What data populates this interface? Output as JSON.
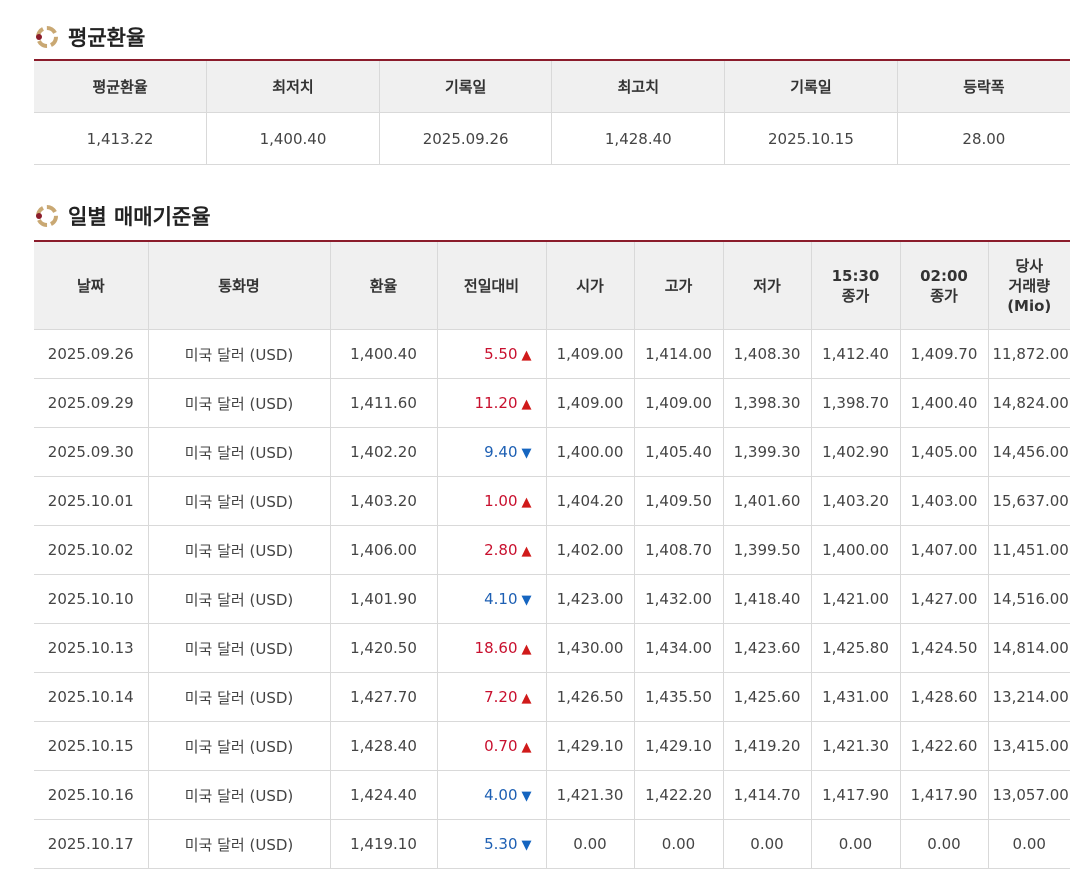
{
  "colors": {
    "accent": "#8b1c2b",
    "up": "#c8102e",
    "down": "#1d5fb3",
    "header_bg": "#f0f0f0"
  },
  "average_section": {
    "title": "평균환율",
    "headers": [
      "평균환율",
      "최저치",
      "기록일",
      "최고치",
      "기록일",
      "등락폭"
    ],
    "values": [
      "1,413.22",
      "1,400.40",
      "2025.09.26",
      "1,428.40",
      "2025.10.15",
      "28.00"
    ]
  },
  "daily_section": {
    "title": "일별 매매기준율",
    "headers": {
      "date": "날짜",
      "currency": "통화명",
      "rate": "환율",
      "change": "전일대비",
      "open": "시가",
      "high": "고가",
      "low": "저가",
      "close1530_l1": "15:30",
      "close1530_l2": "종가",
      "close0200_l1": "02:00",
      "close0200_l2": "종가",
      "volume_l1": "당사",
      "volume_l2": "거래량",
      "volume_l3": "(Mio)"
    },
    "rows": [
      {
        "date": "2025.09.26",
        "currency": "미국 달러 (USD)",
        "rate": "1,400.40",
        "change": "5.50",
        "dir": "up",
        "open": "1,409.00",
        "high": "1,414.00",
        "low": "1,408.30",
        "c1530": "1,412.40",
        "c0200": "1,409.70",
        "vol": "11,872.00"
      },
      {
        "date": "2025.09.29",
        "currency": "미국 달러 (USD)",
        "rate": "1,411.60",
        "change": "11.20",
        "dir": "up",
        "open": "1,409.00",
        "high": "1,409.00",
        "low": "1,398.30",
        "c1530": "1,398.70",
        "c0200": "1,400.40",
        "vol": "14,824.00"
      },
      {
        "date": "2025.09.30",
        "currency": "미국 달러 (USD)",
        "rate": "1,402.20",
        "change": "9.40",
        "dir": "down",
        "open": "1,400.00",
        "high": "1,405.40",
        "low": "1,399.30",
        "c1530": "1,402.90",
        "c0200": "1,405.00",
        "vol": "14,456.00"
      },
      {
        "date": "2025.10.01",
        "currency": "미국 달러 (USD)",
        "rate": "1,403.20",
        "change": "1.00",
        "dir": "up",
        "open": "1,404.20",
        "high": "1,409.50",
        "low": "1,401.60",
        "c1530": "1,403.20",
        "c0200": "1,403.00",
        "vol": "15,637.00"
      },
      {
        "date": "2025.10.02",
        "currency": "미국 달러 (USD)",
        "rate": "1,406.00",
        "change": "2.80",
        "dir": "up",
        "open": "1,402.00",
        "high": "1,408.70",
        "low": "1,399.50",
        "c1530": "1,400.00",
        "c0200": "1,407.00",
        "vol": "11,451.00"
      },
      {
        "date": "2025.10.10",
        "currency": "미국 달러 (USD)",
        "rate": "1,401.90",
        "change": "4.10",
        "dir": "down",
        "open": "1,423.00",
        "high": "1,432.00",
        "low": "1,418.40",
        "c1530": "1,421.00",
        "c0200": "1,427.00",
        "vol": "14,516.00"
      },
      {
        "date": "2025.10.13",
        "currency": "미국 달러 (USD)",
        "rate": "1,420.50",
        "change": "18.60",
        "dir": "up",
        "open": "1,430.00",
        "high": "1,434.00",
        "low": "1,423.60",
        "c1530": "1,425.80",
        "c0200": "1,424.50",
        "vol": "14,814.00"
      },
      {
        "date": "2025.10.14",
        "currency": "미국 달러 (USD)",
        "rate": "1,427.70",
        "change": "7.20",
        "dir": "up",
        "open": "1,426.50",
        "high": "1,435.50",
        "low": "1,425.60",
        "c1530": "1,431.00",
        "c0200": "1,428.60",
        "vol": "13,214.00"
      },
      {
        "date": "2025.10.15",
        "currency": "미국 달러 (USD)",
        "rate": "1,428.40",
        "change": "0.70",
        "dir": "up",
        "open": "1,429.10",
        "high": "1,429.10",
        "low": "1,419.20",
        "c1530": "1,421.30",
        "c0200": "1,422.60",
        "vol": "13,415.00"
      },
      {
        "date": "2025.10.16",
        "currency": "미국 달러 (USD)",
        "rate": "1,424.40",
        "change": "4.00",
        "dir": "down",
        "open": "1,421.30",
        "high": "1,422.20",
        "low": "1,414.70",
        "c1530": "1,417.90",
        "c0200": "1,417.90",
        "vol": "13,057.00"
      },
      {
        "date": "2025.10.17",
        "currency": "미국 달러 (USD)",
        "rate": "1,419.10",
        "change": "5.30",
        "dir": "down",
        "open": "0.00",
        "high": "0.00",
        "low": "0.00",
        "c1530": "0.00",
        "c0200": "0.00",
        "vol": "0.00"
      }
    ]
  }
}
